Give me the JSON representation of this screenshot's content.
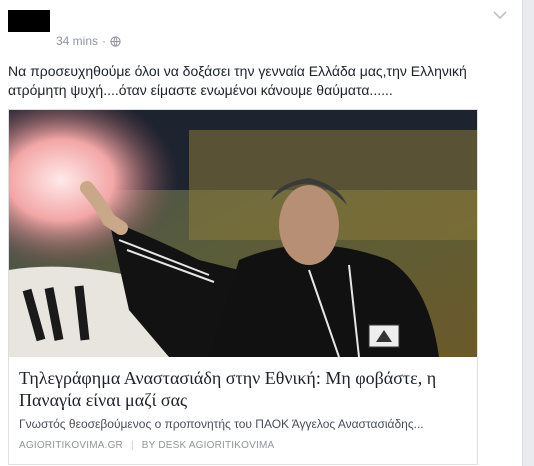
{
  "post": {
    "timestamp": "34 mins",
    "dot": "·",
    "privacy_icon": "globe-icon",
    "options_icon": "chevron-down-icon",
    "text": "Να προσευχηθούμε όλοι να δοξάσει την γενναία Ελλάδα μας,την Ελληνική ατρόμητη ψυχή....όταν είμαστε ενωμένοι κάνουμε θαύματα......"
  },
  "link": {
    "title": "Τηλεγράφημα Αναστασιάδη στην Εθνική: Μη φοβάστε, η Παναγία είναι μαζί σας",
    "description": "Γνωστός θεοσεβούμενος ο προπονητής του ΠΑΟΚ Άγγελος Αναστασιάδης...",
    "source": "AGIORITIKOVIMA.GR",
    "separator": "|",
    "byline": "BY DESK AGIORITIKOVIMA"
  },
  "colors": {
    "meta": "#90949c",
    "border": "#dddfe2",
    "text": "#1d2129"
  }
}
